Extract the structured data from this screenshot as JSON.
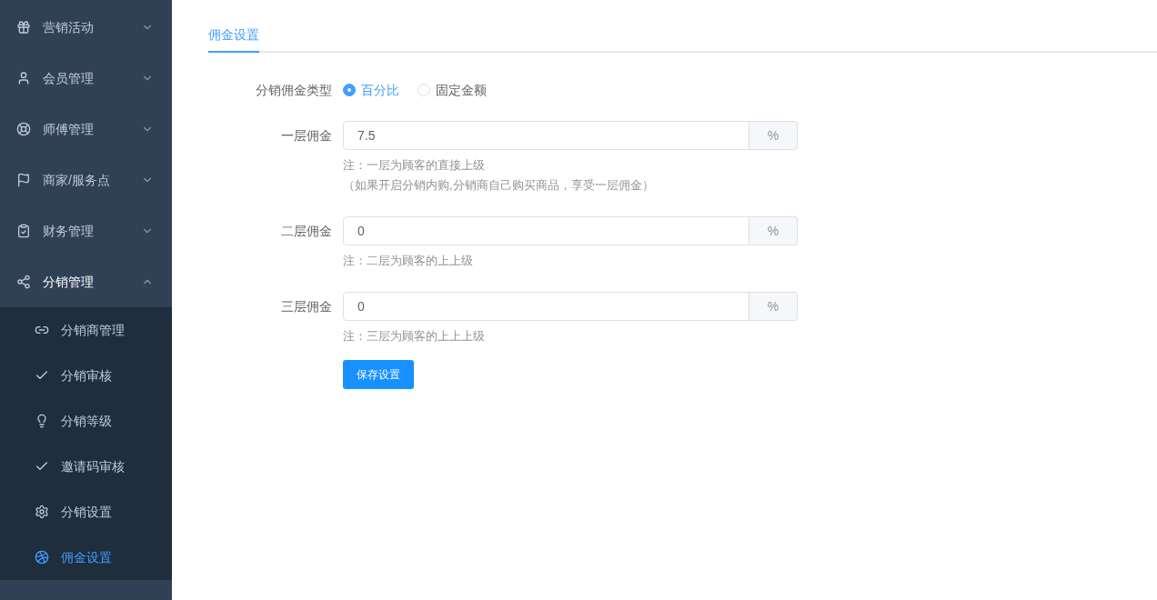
{
  "sidebar": {
    "items": [
      {
        "label": "营销活动",
        "expanded": false
      },
      {
        "label": "会员管理",
        "expanded": false
      },
      {
        "label": "师傅管理",
        "expanded": false
      },
      {
        "label": "商家/服务点",
        "expanded": false
      },
      {
        "label": "财务管理",
        "expanded": false
      },
      {
        "label": "分销管理",
        "expanded": true,
        "children": [
          {
            "label": "分销商管理",
            "selected": false
          },
          {
            "label": "分销审核",
            "selected": false
          },
          {
            "label": "分销等级",
            "selected": false
          },
          {
            "label": "邀请码审核",
            "selected": false
          },
          {
            "label": "分销设置",
            "selected": false
          },
          {
            "label": "佣金设置",
            "selected": true
          }
        ]
      }
    ]
  },
  "tabs": [
    {
      "label": "佣金设置",
      "selected": true
    }
  ],
  "form": {
    "type_label": "分销佣金类型",
    "type_options": [
      {
        "label": "百分比",
        "selected": true
      },
      {
        "label": "固定金额",
        "selected": false
      }
    ],
    "fields": [
      {
        "label": "一层佣金",
        "value": "7.5",
        "unit": "%",
        "notes": [
          "注：一层为顾客的直接上级",
          "（如果开启分销内购,分销商自己购买商品，享受一层佣金）"
        ]
      },
      {
        "label": "二层佣金",
        "value": "0",
        "unit": "%",
        "notes": [
          "注：二层为顾客的上上级"
        ]
      },
      {
        "label": "三层佣金",
        "value": "0",
        "unit": "%",
        "notes": [
          "注：三层为顾客的上上上级"
        ]
      }
    ],
    "submit": "保存设置"
  }
}
